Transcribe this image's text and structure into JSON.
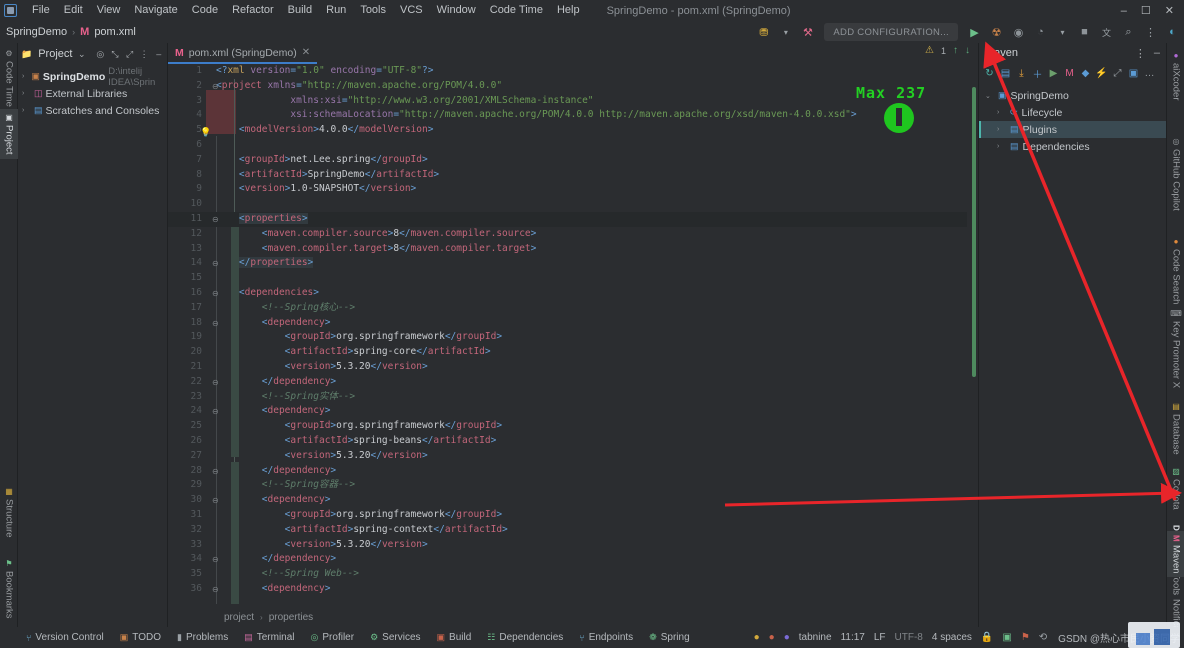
{
  "window": {
    "title": "SpringDemo - pom.xml (SpringDemo)",
    "minimize": "–",
    "maximize": "☐",
    "close": "✕"
  },
  "menu": {
    "items": [
      "File",
      "Edit",
      "View",
      "Navigate",
      "Code",
      "Refactor",
      "Build",
      "Run",
      "Tools",
      "VCS",
      "Window",
      "Code Time",
      "Help"
    ]
  },
  "toolbar": {
    "breadcrumb": {
      "project": "SpringDemo",
      "separator": "›",
      "file": "pom.xml",
      "file_icon": "maven-m-icon"
    },
    "add_configuration": "ADD CONFIGURATION...",
    "icons": [
      {
        "name": "user-group-icon",
        "glyph": "⛃"
      },
      {
        "name": "build-hammer-icon",
        "glyph": "⚒"
      },
      {
        "name": "run-icon",
        "glyph": "▶"
      },
      {
        "name": "debug-icon",
        "glyph": "☢"
      },
      {
        "name": "run-coverage-icon",
        "glyph": "◉"
      },
      {
        "name": "profiler-icon",
        "glyph": "◔"
      },
      {
        "name": "stop-icon",
        "glyph": "■"
      },
      {
        "name": "translate-icon",
        "glyph": "文"
      },
      {
        "name": "search-everywhere-icon",
        "glyph": "⌕"
      },
      {
        "name": "more-options-icon",
        "glyph": "⋮"
      },
      {
        "name": "ide-help-icon",
        "glyph": "◐"
      }
    ]
  },
  "left_rail": {
    "items": [
      {
        "label": "Code Time",
        "icon": "clock-icon",
        "glyph": "⚙",
        "selected": false
      },
      {
        "label": "Project",
        "icon": "project-icon",
        "glyph": "▣",
        "selected": true
      },
      {
        "label": "Structure",
        "icon": "structure-icon",
        "glyph": "▦",
        "selected": false
      },
      {
        "label": "Bookmarks",
        "icon": "bookmark-icon",
        "glyph": "⚑",
        "selected": false
      }
    ]
  },
  "right_rail": {
    "items": [
      {
        "label": "aiXcoder",
        "icon": "aixcoder-icon",
        "glyph": "●",
        "selected": false
      },
      {
        "label": "GitHub Copilot",
        "icon": "copilot-icon",
        "glyph": "◎",
        "selected": false
      },
      {
        "label": "Code Search",
        "icon": "code-search-icon",
        "glyph": "●",
        "selected": false
      },
      {
        "label": "Key Promoter X",
        "icon": "key-promoter-icon",
        "glyph": "⌨",
        "selected": false
      },
      {
        "label": "Database",
        "icon": "database-icon",
        "glyph": "▤",
        "selected": false
      },
      {
        "label": "Codota",
        "icon": "codota-icon",
        "glyph": "▨",
        "selected": false
      },
      {
        "label": "Big Data Tools",
        "icon": "big-data-icon",
        "glyph": "D",
        "selected": false
      },
      {
        "label": "Maven",
        "icon": "maven-icon",
        "glyph": "M",
        "selected": true
      },
      {
        "label": "Notifications",
        "icon": "notifications-icon",
        "glyph": "□",
        "selected": false
      }
    ]
  },
  "project_panel": {
    "title": "Project",
    "header_icons": [
      {
        "name": "chevron-down-icon",
        "glyph": "⌄"
      },
      {
        "name": "target-icon",
        "glyph": "◎"
      },
      {
        "name": "expand-all-icon",
        "glyph": "⤡"
      },
      {
        "name": "collapse-all-icon",
        "glyph": "⤢"
      },
      {
        "name": "panel-options-icon",
        "glyph": "⋮"
      },
      {
        "name": "hide-panel-icon",
        "glyph": "–"
      }
    ],
    "tree": [
      {
        "label": "SpringDemo",
        "path": "D:\\intelij IDEA\\Sprin",
        "icon": "module-icon",
        "glyph": "▣",
        "arrow": "›",
        "bold": true
      },
      {
        "label": "External Libraries",
        "path": "",
        "icon": "library-icon",
        "glyph": "◫",
        "arrow": "›",
        "bold": false
      },
      {
        "label": "Scratches and Consoles",
        "path": "",
        "icon": "scratch-icon",
        "glyph": "▤",
        "arrow": "›",
        "bold": false
      }
    ]
  },
  "editor": {
    "tab": {
      "label": "pom.xml (SpringDemo)",
      "icon": "maven-m-icon",
      "close": "✕"
    },
    "inspection": {
      "warning_icon": "warning-triangle-icon",
      "warning_count": "1",
      "prev": "↑",
      "next": "↓"
    },
    "breadcrumb": [
      "project",
      "properties"
    ],
    "separator": "›",
    "lines": [
      {
        "n": "1",
        "html": "<span class=\"tb\">&lt;?</span><span class=\"pi\">xml </span><span class=\"ta\">version</span><span class=\"tb\">=</span><span class=\"tv\">\"1.0\"</span> <span class=\"ta\">encoding</span><span class=\"tb\">=</span><span class=\"tv\">\"UTF-8\"</span><span class=\"tb\">?&gt;</span>"
      },
      {
        "n": "2",
        "html": "<span class=\"tb\">&lt;</span><span class=\"tg\">project</span> <span class=\"ta\">xmlns</span><span class=\"tb\">=</span><span class=\"tv\">\"http://maven.apache.org/POM/4.0.0\"</span>"
      },
      {
        "n": "3",
        "html": "             <span class=\"ta\">xmlns:xsi</span><span class=\"tb\">=</span><span class=\"tv\">\"http://www.w3.org/2001/XMLSchema-instance\"</span>"
      },
      {
        "n": "4",
        "html": "             <span class=\"ta\">xsi:schemaLocation</span><span class=\"tb\">=</span><span class=\"tv\">\"http://maven.apache.org/POM/4.0.0 http://maven.apache.org/xsd/maven-4.0.0.xsd\"</span><span class=\"tb\">&gt;</span>"
      },
      {
        "n": "5",
        "html": "    <span class=\"tb\">&lt;</span><span class=\"tg\">modelVersion</span><span class=\"tb\">&gt;</span><span class=\"txt\">4.0.0</span><span class=\"tb\">&lt;/</span><span class=\"tg\">modelVersion</span><span class=\"tb\">&gt;</span>"
      },
      {
        "n": "6",
        "html": ""
      },
      {
        "n": "7",
        "html": "    <span class=\"tb\">&lt;</span><span class=\"tg\">groupId</span><span class=\"tb\">&gt;</span><span class=\"txt\">net.Lee.spring</span><span class=\"tb\">&lt;/</span><span class=\"tg\">groupId</span><span class=\"tb\">&gt;</span>"
      },
      {
        "n": "8",
        "html": "    <span class=\"tb\">&lt;</span><span class=\"tg\">artifactId</span><span class=\"tb\">&gt;</span><span class=\"txt\">SpringDemo</span><span class=\"tb\">&lt;/</span><span class=\"tg\">artifactId</span><span class=\"tb\">&gt;</span>"
      },
      {
        "n": "9",
        "html": "    <span class=\"tb\">&lt;</span><span class=\"tg\">version</span><span class=\"tb\">&gt;</span><span class=\"txt\">1.0-SNAPSHOT</span><span class=\"tb\">&lt;/</span><span class=\"tg\">version</span><span class=\"tb\">&gt;</span>"
      },
      {
        "n": "10",
        "html": ""
      },
      {
        "n": "11",
        "html": "    <span class=\"hl\"><span class=\"tb\">&lt;</span><span class=\"tg\">properties</span><span class=\"tb\">&gt;</span></span>"
      },
      {
        "n": "12",
        "html": "        <span class=\"tb\">&lt;</span><span class=\"tg\">maven.compiler.source</span><span class=\"tb\">&gt;</span><span class=\"txt\">8</span><span class=\"tb\">&lt;/</span><span class=\"tg\">maven.compiler.source</span><span class=\"tb\">&gt;</span>"
      },
      {
        "n": "13",
        "html": "        <span class=\"tb\">&lt;</span><span class=\"tg\">maven.compiler.target</span><span class=\"tb\">&gt;</span><span class=\"txt\">8</span><span class=\"tb\">&lt;/</span><span class=\"tg\">maven.compiler.target</span><span class=\"tb\">&gt;</span>"
      },
      {
        "n": "14",
        "html": "    <span class=\"hl\"><span class=\"tb\">&lt;/</span><span class=\"tg\">properties</span><span class=\"tb\">&gt;</span></span>"
      },
      {
        "n": "15",
        "html": ""
      },
      {
        "n": "16",
        "html": "    <span class=\"tb\">&lt;</span><span class=\"tg\">dependencies</span><span class=\"tb\">&gt;</span>"
      },
      {
        "n": "17",
        "html": "        <span class=\"cm\">&lt;!--Spring核心--&gt;</span>"
      },
      {
        "n": "18",
        "html": "        <span class=\"tb\">&lt;</span><span class=\"tg\">dependency</span><span class=\"tb\">&gt;</span>"
      },
      {
        "n": "19",
        "html": "            <span class=\"tb\">&lt;</span><span class=\"tg\">groupId</span><span class=\"tb\">&gt;</span><span class=\"txt\">org.springframework</span><span class=\"tb\">&lt;/</span><span class=\"tg\">groupId</span><span class=\"tb\">&gt;</span>"
      },
      {
        "n": "20",
        "html": "            <span class=\"tb\">&lt;</span><span class=\"tg\">artifactId</span><span class=\"tb\">&gt;</span><span class=\"txt\">spring-core</span><span class=\"tb\">&lt;/</span><span class=\"tg\">artifactId</span><span class=\"tb\">&gt;</span>"
      },
      {
        "n": "21",
        "html": "            <span class=\"tb\">&lt;</span><span class=\"tg\">version</span><span class=\"tb\">&gt;</span><span class=\"txt\">5.3.20</span><span class=\"tb\">&lt;/</span><span class=\"tg\">version</span><span class=\"tb\">&gt;</span>"
      },
      {
        "n": "22",
        "html": "        <span class=\"tb\">&lt;/</span><span class=\"tg\">dependency</span><span class=\"tb\">&gt;</span>"
      },
      {
        "n": "23",
        "html": "        <span class=\"cm\">&lt;!--Spring实体--&gt;</span>"
      },
      {
        "n": "24",
        "html": "        <span class=\"tb\">&lt;</span><span class=\"tg\">dependency</span><span class=\"tb\">&gt;</span>"
      },
      {
        "n": "25",
        "html": "            <span class=\"tb\">&lt;</span><span class=\"tg\">groupId</span><span class=\"tb\">&gt;</span><span class=\"txt\">org.springframework</span><span class=\"tb\">&lt;/</span><span class=\"tg\">groupId</span><span class=\"tb\">&gt;</span>"
      },
      {
        "n": "26",
        "html": "            <span class=\"tb\">&lt;</span><span class=\"tg\">artifactId</span><span class=\"tb\">&gt;</span><span class=\"txt\">spring-beans</span><span class=\"tb\">&lt;/</span><span class=\"tg\">artifactId</span><span class=\"tb\">&gt;</span>"
      },
      {
        "n": "27",
        "html": "            <span class=\"tb\">&lt;</span><span class=\"tg\">version</span><span class=\"tb\">&gt;</span><span class=\"txt\">5.3.20</span><span class=\"tb\">&lt;/</span><span class=\"tg\">version</span><span class=\"tb\">&gt;</span>"
      },
      {
        "n": "28",
        "html": "        <span class=\"tb\">&lt;/</span><span class=\"tg\">dependency</span><span class=\"tb\">&gt;</span>"
      },
      {
        "n": "29",
        "html": "        <span class=\"cm\">&lt;!--Spring容器--&gt;</span>"
      },
      {
        "n": "30",
        "html": "        <span class=\"tb\">&lt;</span><span class=\"tg\">dependency</span><span class=\"tb\">&gt;</span>"
      },
      {
        "n": "31",
        "html": "            <span class=\"tb\">&lt;</span><span class=\"tg\">groupId</span><span class=\"tb\">&gt;</span><span class=\"txt\">org.springframework</span><span class=\"tb\">&lt;/</span><span class=\"tg\">groupId</span><span class=\"tb\">&gt;</span>"
      },
      {
        "n": "32",
        "html": "            <span class=\"tb\">&lt;</span><span class=\"tg\">artifactId</span><span class=\"tb\">&gt;</span><span class=\"txt\">spring-context</span><span class=\"tb\">&lt;/</span><span class=\"tg\">artifactId</span><span class=\"tb\">&gt;</span>"
      },
      {
        "n": "33",
        "html": "            <span class=\"tb\">&lt;</span><span class=\"tg\">version</span><span class=\"tb\">&gt;</span><span class=\"txt\">5.3.20</span><span class=\"tb\">&lt;/</span><span class=\"tg\">version</span><span class=\"tb\">&gt;</span>"
      },
      {
        "n": "34",
        "html": "        <span class=\"tb\">&lt;/</span><span class=\"tg\">dependency</span><span class=\"tb\">&gt;</span>"
      },
      {
        "n": "35",
        "html": "        <span class=\"cm\">&lt;!--Spring Web--&gt;</span>"
      },
      {
        "n": "36",
        "html": "        <span class=\"tb\">&lt;</span><span class=\"tg\">dependency</span><span class=\"tb\">&gt;</span>"
      }
    ]
  },
  "maven_panel": {
    "title": "Maven",
    "header_icons": [
      {
        "name": "panel-options-icon",
        "glyph": "⋮"
      },
      {
        "name": "hide-panel-icon",
        "glyph": "–"
      }
    ],
    "toolbar_icons": [
      {
        "name": "reload-project-icon",
        "glyph": "↻",
        "color": "#4db6ac"
      },
      {
        "name": "generate-sources-icon",
        "glyph": "▤",
        "color": "#5b9bd5"
      },
      {
        "name": "download-sources-icon",
        "glyph": "⤓",
        "color": "#e8a33d"
      },
      {
        "name": "add-maven-project-icon",
        "glyph": "＋",
        "color": "#5b9bd5"
      },
      {
        "name": "run-maven-build-icon",
        "glyph": "▶",
        "color": "#6c9f6c"
      },
      {
        "name": "maven-goal-icon",
        "glyph": "M",
        "color": "#e8618c"
      },
      {
        "name": "toggle-offline-icon",
        "glyph": "◆",
        "color": "#5b9bd5"
      },
      {
        "name": "skip-tests-icon",
        "glyph": "⚡",
        "color": "#e8c349"
      },
      {
        "name": "expand-all-icon",
        "glyph": "⤢",
        "color": "#9aa0a5"
      },
      {
        "name": "show-diagram-icon",
        "glyph": "▣",
        "color": "#5b9bd5"
      },
      {
        "name": "more-actions-icon",
        "glyph": "…",
        "color": "#9aa0a5"
      }
    ],
    "tree": [
      {
        "label": "SpringDemo",
        "arrow": "⌄",
        "icon": "maven-module-icon",
        "glyph": "▣",
        "indent": 0,
        "selected": false
      },
      {
        "label": "Lifecycle",
        "arrow": "›",
        "icon": "lifecycle-icon",
        "glyph": "⟳",
        "indent": 1,
        "selected": false
      },
      {
        "label": "Plugins",
        "arrow": "›",
        "icon": "plugins-folder-icon",
        "glyph": "▤",
        "indent": 1,
        "selected": true
      },
      {
        "label": "Dependencies",
        "arrow": "›",
        "icon": "dependencies-folder-icon",
        "glyph": "▤",
        "indent": 1,
        "selected": false
      }
    ]
  },
  "overlay": {
    "max_label": "Max 237",
    "annotation_color": "#e8252a",
    "pixel_green": "#23d023"
  },
  "statusbar": {
    "tools": [
      {
        "label": "Version Control",
        "icon": "branch-icon",
        "glyph": "⑂",
        "color": "#6aa7c8"
      },
      {
        "label": "TODO",
        "icon": "todo-icon",
        "glyph": "▣",
        "color": "#c8824a"
      },
      {
        "label": "Problems",
        "icon": "problems-icon",
        "glyph": "▮",
        "color": "#9aa0a5"
      },
      {
        "label": "Terminal",
        "icon": "terminal-icon",
        "glyph": "▤",
        "color": "#c86a9e"
      },
      {
        "label": "Profiler",
        "icon": "profiler-icon",
        "glyph": "◎",
        "color": "#6cbf8a"
      },
      {
        "label": "Services",
        "icon": "services-icon",
        "glyph": "⚙",
        "color": "#6cbf8a"
      },
      {
        "label": "Build",
        "icon": "build-icon",
        "glyph": "▣",
        "color": "#c8624a"
      },
      {
        "label": "Dependencies",
        "icon": "dependencies-icon",
        "glyph": "☷",
        "color": "#6cbf8a"
      },
      {
        "label": "Endpoints",
        "icon": "endpoints-icon",
        "glyph": "⑂",
        "color": "#6aa7c8"
      },
      {
        "label": "Spring",
        "icon": "spring-leaf-icon",
        "glyph": "❁",
        "color": "#6cbf8a"
      }
    ],
    "right": {
      "tabnine": "tabnine",
      "position": "11:17",
      "line_separator": "LF",
      "encoding": "UTF-8",
      "indent": "4 spaces",
      "lock_icon": "lock-icon",
      "icons": [
        {
          "name": "notification-warning-icon",
          "glyph": "◆",
          "color": "#e8a33d"
        },
        {
          "name": "codota-status-icon",
          "glyph": "●",
          "color": "#c8624a"
        },
        {
          "name": "tabnine-status-icon",
          "glyph": "●",
          "color": "#7b6bd6"
        },
        {
          "name": "git-status-icon",
          "glyph": "▣",
          "color": "#6cbf8a"
        },
        {
          "name": "ide-error-icon",
          "glyph": "⚑",
          "color": "#c8624a"
        },
        {
          "name": "history-icon",
          "glyph": "⟲",
          "color": "#9aa0a5"
        }
      ],
      "watermark": "GSDN @热心市民小资同学"
    }
  }
}
